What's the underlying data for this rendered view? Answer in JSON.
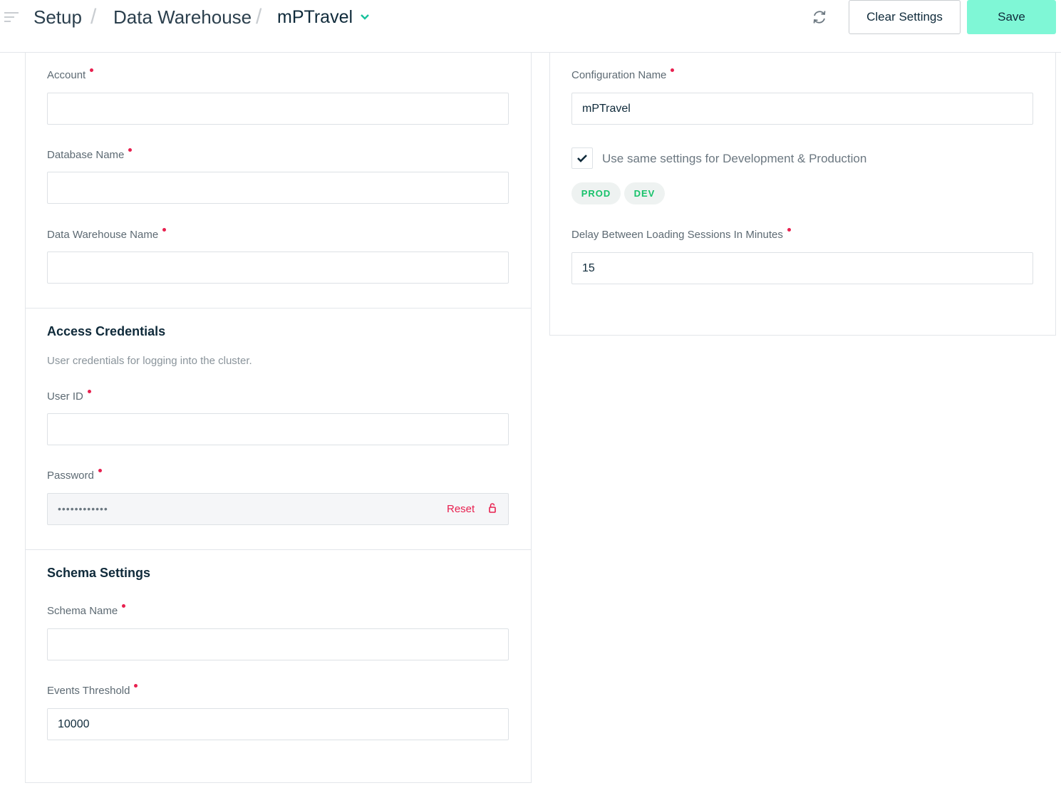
{
  "header": {
    "breadcrumb": [
      "Setup",
      "Data Warehouse"
    ],
    "current": "mPTravel",
    "clear_label": "Clear Settings",
    "save_label": "Save"
  },
  "colors": {
    "accent": "#7ff7d6",
    "required": "#e8204f",
    "env_tag": "#18c26b"
  },
  "left": {
    "account": {
      "label": "Account",
      "value": ""
    },
    "database_name": {
      "label": "Database Name",
      "value": ""
    },
    "warehouse_name": {
      "label": "Data Warehouse Name",
      "value": ""
    },
    "credentials": {
      "title": "Access Credentials",
      "description": "User credentials for logging into the cluster.",
      "user_id": {
        "label": "User ID",
        "value": ""
      },
      "password": {
        "label": "Password",
        "masked": "••••••••••••",
        "reset_label": "Reset"
      }
    },
    "schema": {
      "title": "Schema Settings",
      "schema_name": {
        "label": "Schema Name",
        "value": ""
      },
      "events_threshold": {
        "label": "Events Threshold",
        "value": "10000"
      }
    }
  },
  "right": {
    "config_name": {
      "label": "Configuration Name",
      "value": "mPTravel"
    },
    "same_settings": {
      "label": "Use same settings for Development & Production",
      "checked": true
    },
    "env_tags": [
      "PROD",
      "DEV"
    ],
    "delay": {
      "label": "Delay Between Loading Sessions In Minutes",
      "value": "15"
    }
  },
  "icons": {
    "menu": "menu-icon",
    "dropdown": "chevron-down-icon",
    "refresh": "refresh-icon",
    "lock": "lock-icon",
    "check": "check-icon"
  }
}
